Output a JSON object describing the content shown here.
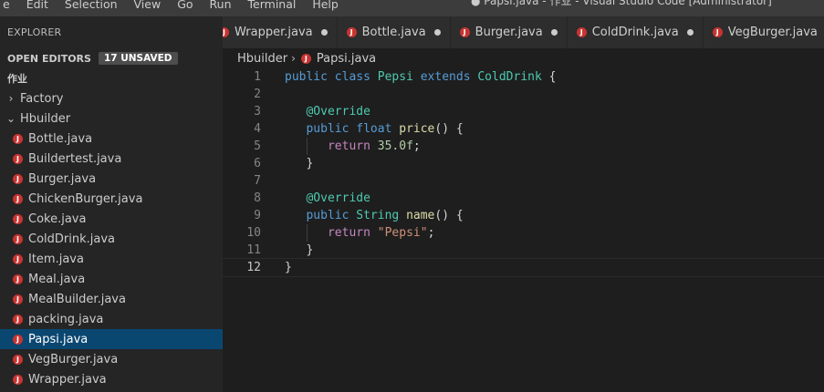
{
  "menu": [
    "e",
    "Edit",
    "Selection",
    "View",
    "Go",
    "Run",
    "Terminal",
    "Help"
  ],
  "window_title": "● Papsi.java - 作业 - Visual Studio Code [Administrator]",
  "sidebar": {
    "explorer_title": "EXPLORER",
    "open_editors_label": "OPEN EDITORS",
    "unsaved_badge": "17 UNSAVED",
    "workspace_label": "作业",
    "folders": [
      {
        "label": "Factory",
        "expanded": false
      },
      {
        "label": "Hbuilder",
        "expanded": true
      }
    ],
    "files": [
      "Bottle.java",
      "Buildertest.java",
      "Burger.java",
      "ChickenBurger.java",
      "Coke.java",
      "ColdDrink.java",
      "Item.java",
      "Meal.java",
      "MealBuilder.java",
      "packing.java",
      "Papsi.java",
      "VegBurger.java",
      "Wrapper.java"
    ],
    "selected_file": "Papsi.java"
  },
  "tabs": [
    "Wrapper.java",
    "Bottle.java",
    "Burger.java",
    "ColdDrink.java",
    "VegBurger.java"
  ],
  "breadcrumbs": {
    "folder": "Hbuilder",
    "file": "Papsi.java"
  },
  "icons": {
    "java_file": "java-file-icon",
    "unsaved": "unsaved-dot-icon",
    "chevron_right": "chevron-right-icon",
    "chevron_down": "chevron-down-icon"
  },
  "colors": {
    "keyword": "#569cd6",
    "type": "#4ec9b0",
    "function": "#dcdcaa",
    "string": "#ce9178",
    "number": "#b5cea8",
    "keyword_control": "#c586c0",
    "selection": "#094771",
    "java_icon": "#c93431"
  },
  "editor": {
    "line_numbers": [
      "1",
      "2",
      "3",
      "4",
      "5",
      "6",
      "7",
      "8",
      "9",
      "10",
      "11",
      "12"
    ],
    "current_line": 12,
    "lines": [
      "public class Pepsi extends ColdDrink {",
      "",
      "  @Override",
      "  public float price() {",
      "    return 35.0f;",
      "  }",
      "",
      "  @Override",
      "  public String name() {",
      "    return \"Pepsi\";",
      "  }",
      "}"
    ]
  }
}
